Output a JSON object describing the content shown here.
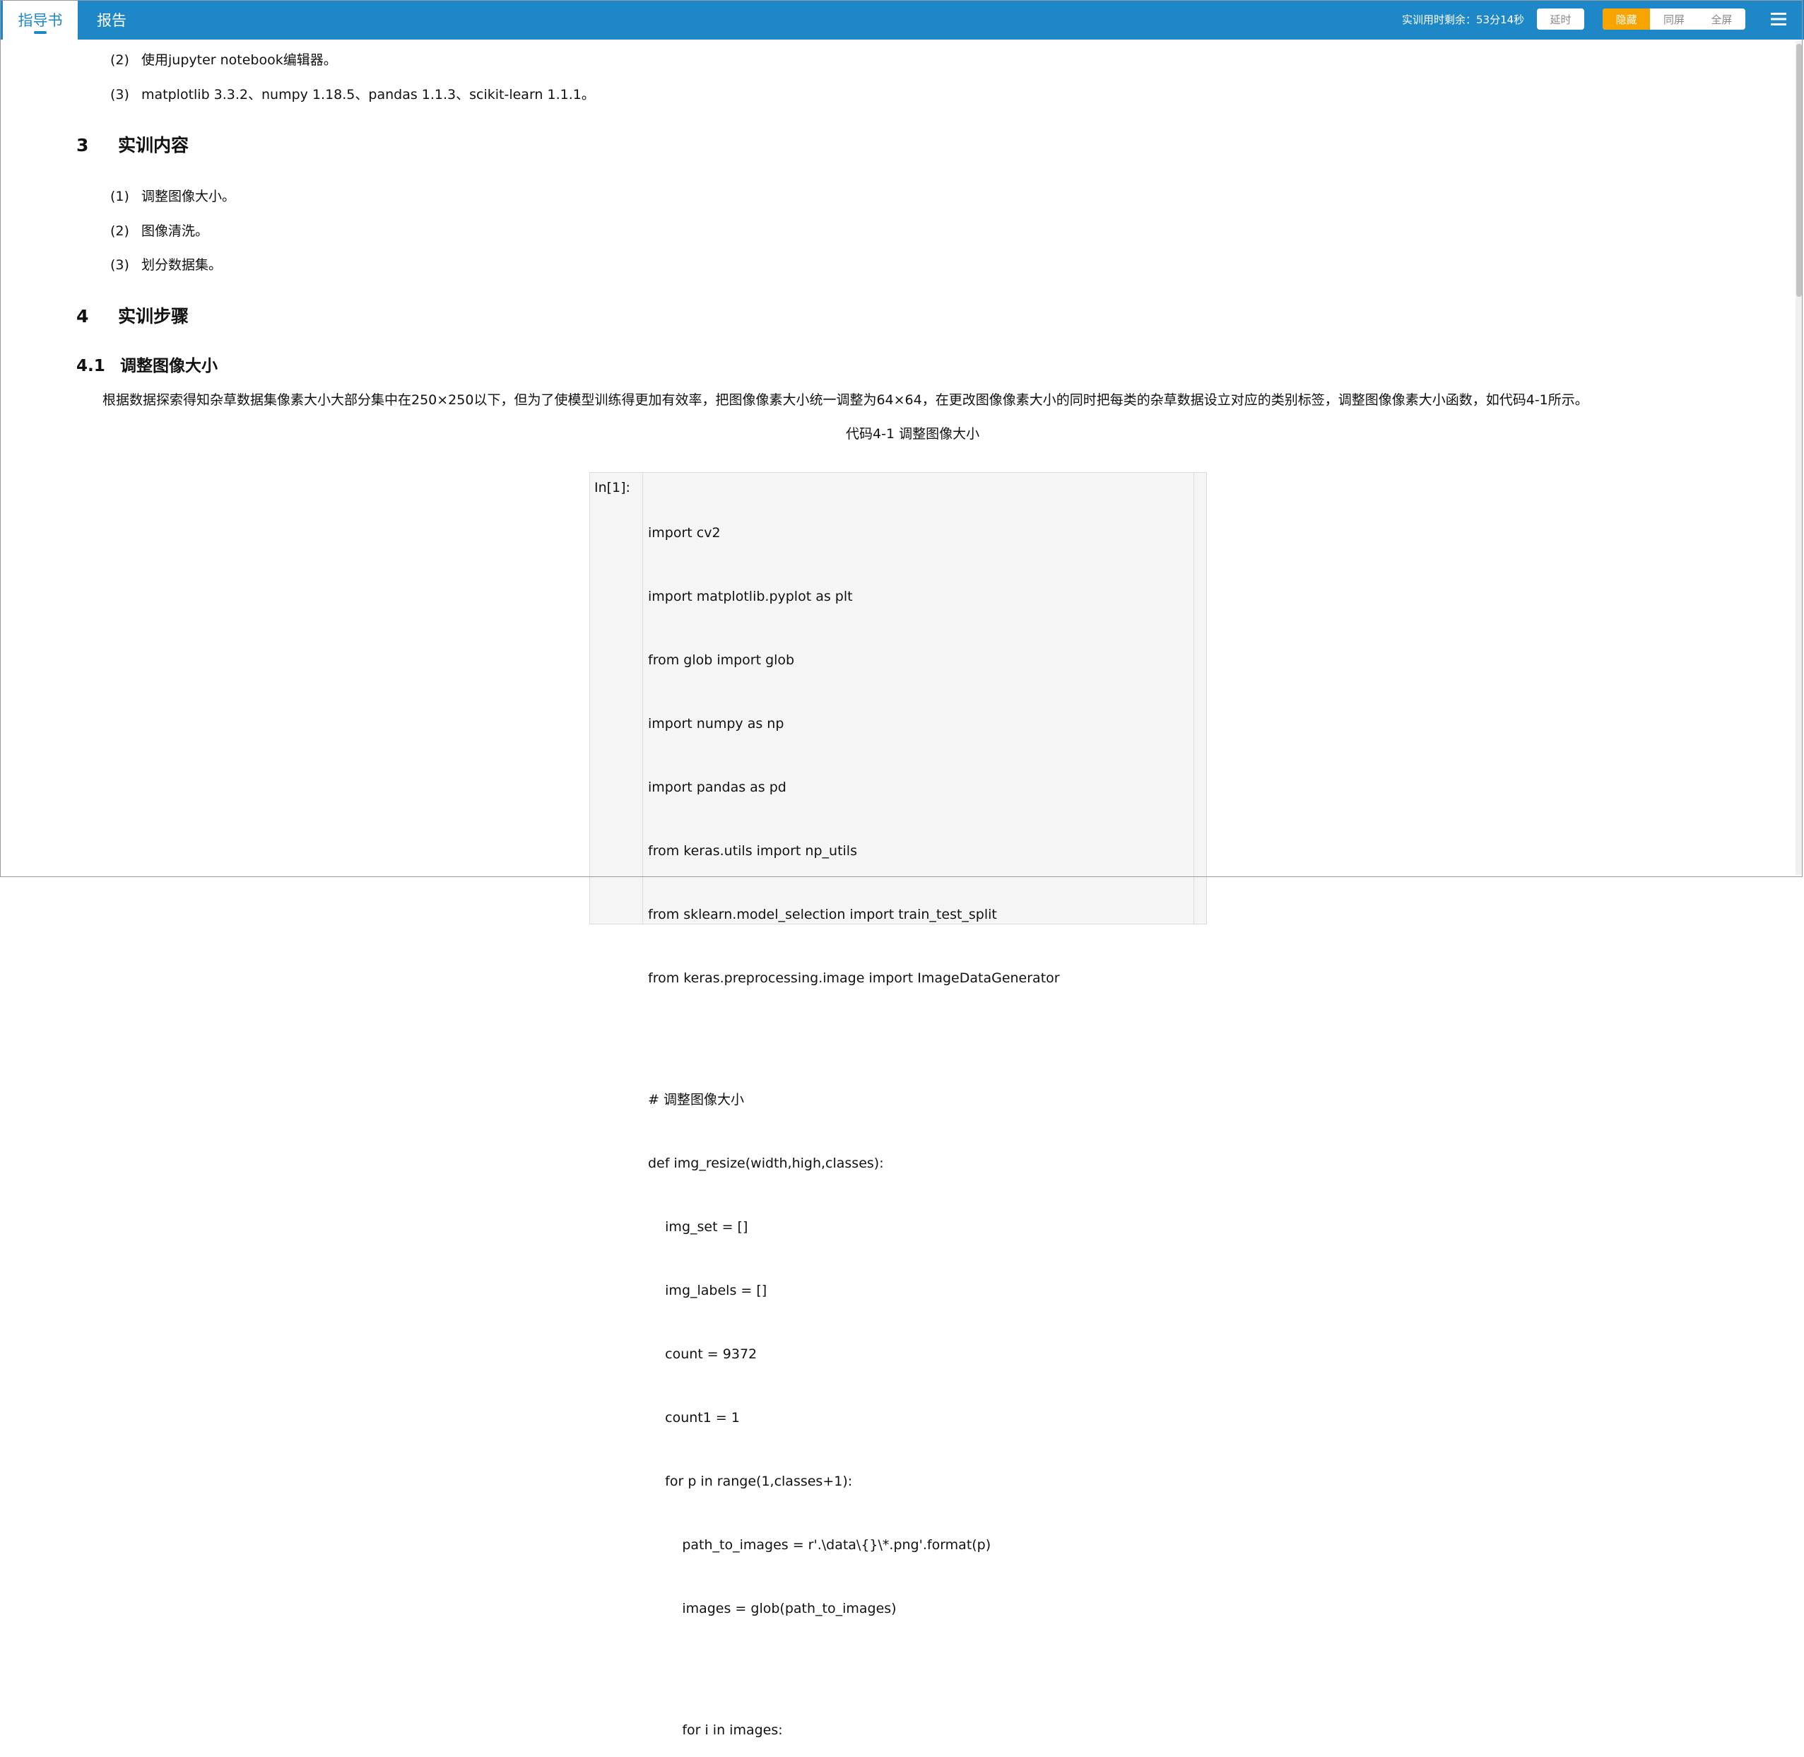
{
  "header": {
    "tabs": [
      {
        "label": "指导书",
        "active": true
      },
      {
        "label": "报告",
        "active": false
      }
    ],
    "timer_text": "实训用时剩余：53分14秒",
    "extend_button": "延时",
    "view_modes": [
      "隐藏",
      "同屏",
      "全屏"
    ],
    "active_view_mode": "隐藏",
    "accent_color": "#1e87c8",
    "highlight_color": "#f7a400"
  },
  "doc": {
    "env_items": [
      {
        "num": "(2)",
        "text": "使用jupyter notebook编辑器。"
      },
      {
        "num": "(3)",
        "text": "matplotlib 3.3.2、numpy 1.18.5、pandas 1.1.3、scikit-learn 1.1.1。"
      }
    ],
    "section3": {
      "num": "3",
      "title": "实训内容"
    },
    "content_items": [
      {
        "num": "(1)",
        "text": "调整图像大小。"
      },
      {
        "num": "(2)",
        "text": "图像清洗。"
      },
      {
        "num": "(3)",
        "text": "划分数据集。"
      }
    ],
    "section4": {
      "num": "4",
      "title": "实训步骤"
    },
    "section41": {
      "num": "4.1",
      "title": "调整图像大小"
    },
    "paragraph": "根据数据探索得知杂草数据集像素大小大部分集中在250×250以下，但为了使模型训练得更加有效率，把图像像素大小统一调整为64×64，在更改图像像素大小的同时把每类的杂草数据设立对应的类别标签，调整图像像素大小函数，如代码4-1所示。",
    "code_caption": "代码4-1 调整图像大小",
    "code_prompt": "In[1]:",
    "code_block1": [
      "import cv2",
      "import matplotlib.pyplot as plt",
      "from glob import glob",
      "import numpy as np",
      "import pandas as pd",
      "from keras.utils import np_utils",
      "from sklearn.model_selection import train_test_split",
      "from keras.preprocessing.image import ImageDataGenerator"
    ],
    "code_block2": [
      "# 调整图像大小",
      "def img_resize(width,high,classes):",
      "    img_set = []",
      "    img_labels = []",
      "    count = 9372",
      "    count1 = 1",
      "    for p in range(1,classes+1):",
      "        path_to_images = r'.\\data\\{}\\*.png'.format(p)",
      "        images = glob(path_to_images)"
    ],
    "code_block3": [
      "        for i in images:"
    ]
  }
}
